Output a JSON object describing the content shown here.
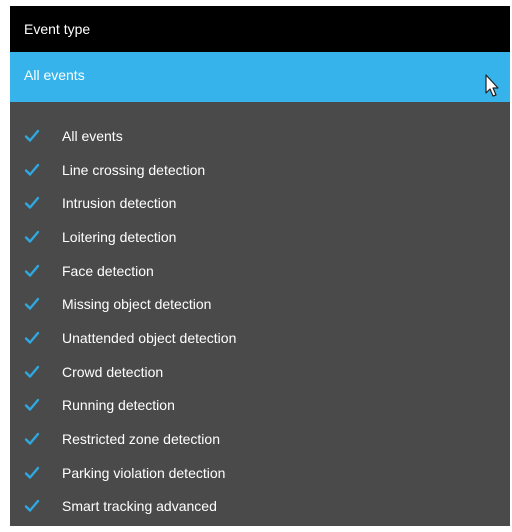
{
  "header": {
    "title": "Event type"
  },
  "dropdown": {
    "selected": "All events"
  },
  "options": [
    {
      "label": "All events",
      "checked": true
    },
    {
      "label": "Line crossing detection",
      "checked": true
    },
    {
      "label": "Intrusion detection",
      "checked": true
    },
    {
      "label": "Loitering detection",
      "checked": true
    },
    {
      "label": "Face detection",
      "checked": true
    },
    {
      "label": "Missing object detection",
      "checked": true
    },
    {
      "label": "Unattended object detection",
      "checked": true
    },
    {
      "label": "Crowd detection",
      "checked": true
    },
    {
      "label": "Running detection",
      "checked": true
    },
    {
      "label": "Restricted zone detection",
      "checked": true
    },
    {
      "label": "Parking violation detection",
      "checked": true
    },
    {
      "label": "Smart tracking advanced",
      "checked": true
    }
  ],
  "colors": {
    "header_bg": "#000000",
    "accent": "#35b3ea",
    "panel_bg": "#4a4a4a",
    "check": "#2fa8e0",
    "text": "#ffffff"
  },
  "icons": {
    "check": "check-icon",
    "cursor": "mouse-cursor-icon"
  }
}
